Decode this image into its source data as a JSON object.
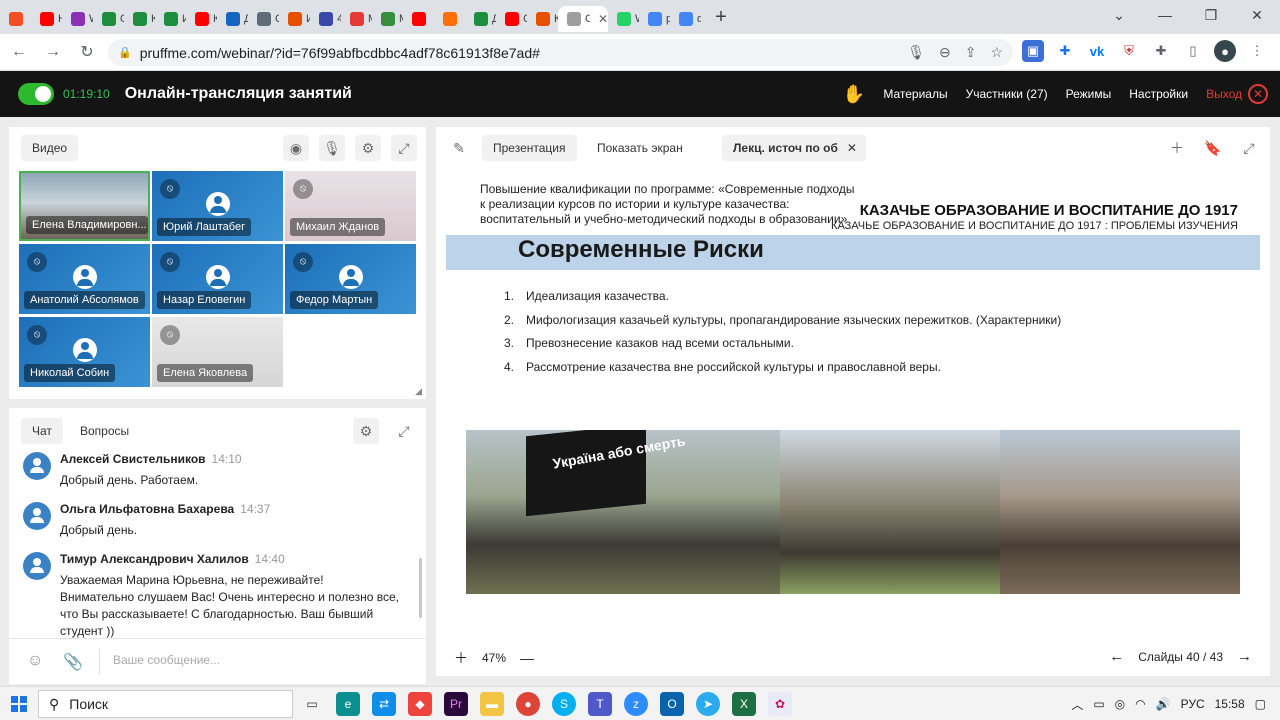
{
  "browser": {
    "tabs": [
      {
        "title": "",
        "color": "#f25022"
      },
      {
        "title": "Н",
        "color": "#ff0000"
      },
      {
        "title": "W",
        "color": "#8b2fb5"
      },
      {
        "title": "О",
        "color": "#1e8e3e"
      },
      {
        "title": "К",
        "color": "#1e8e3e"
      },
      {
        "title": "И",
        "color": "#1e8e3e"
      },
      {
        "title": "К",
        "color": "#ff0000"
      },
      {
        "title": "Д",
        "color": "#1565c0"
      },
      {
        "title": "О",
        "color": "#5f6d7a"
      },
      {
        "title": "И",
        "color": "#e65100"
      },
      {
        "title": "4",
        "color": "#3949ab"
      },
      {
        "title": "М",
        "color": "#e53935"
      },
      {
        "title": "М",
        "color": "#388e3c"
      },
      {
        "title": "",
        "color": "#ff0000"
      },
      {
        "title": "",
        "color": "#ff6f00"
      },
      {
        "title": "Д",
        "color": "#1e8e3e"
      },
      {
        "title": "С",
        "color": "#ff0000"
      },
      {
        "title": "К",
        "color": "#e65100"
      },
      {
        "title": "О",
        "color": "#9e9e9e",
        "active": true
      },
      {
        "title": "W",
        "color": "#25d366"
      },
      {
        "title": "p",
        "color": "#4285f4"
      },
      {
        "title": "ф",
        "color": "#4285f4"
      }
    ],
    "url": "pruffme.com/webinar/?id=76f99abfbcdbbc4adf78c61913f8e7ad#"
  },
  "header": {
    "timer": "01:19:10",
    "title": "Онлайн-трансляция занятий",
    "links": [
      "Материалы",
      "Участники (27)",
      "Режимы",
      "Настройки"
    ],
    "exit": "Выход"
  },
  "video": {
    "label": "Видео",
    "participants": [
      {
        "name": "Елена Владимировн...",
        "style": "cam"
      },
      {
        "name": "Юрий Лаштабег",
        "style": "blue"
      },
      {
        "name": "Михаил Жданов",
        "style": "photo1"
      },
      {
        "name": "Анатолий Абсолямов",
        "style": "blue"
      },
      {
        "name": "Назар Еловегин",
        "style": "blue"
      },
      {
        "name": "Федор Мартын",
        "style": "blue"
      },
      {
        "name": "Николай Собин",
        "style": "blue"
      },
      {
        "name": "Елена Яковлева",
        "style": "photo2"
      }
    ]
  },
  "chat": {
    "tabs": [
      "Чат",
      "Вопросы"
    ],
    "messages": [
      {
        "author": "Алексей Свистельников",
        "time": "14:10",
        "text": "Добрый день. Работаем."
      },
      {
        "author": "Ольга Ильфатовна Бахарева",
        "time": "14:37",
        "text": "Добрый день."
      },
      {
        "author": "Тимур Александрович Халилов",
        "time": "14:40",
        "text": "Уважаемая Марина Юрьевна, не переживайте! Внимательно слушаем Вас! Очень интересно и полезно все, что Вы рассказываете! С благодарностью. Ваш бывший студент ))"
      }
    ],
    "placeholder": "Ваше сообщение..."
  },
  "presentation": {
    "tabs": [
      "Презентация",
      "Показать экран"
    ],
    "file_tab": "Лекц. источ по об",
    "slide": {
      "intro": "Повышение квалификации по программе: «Современные подходы к реализации курсов по истории и культуре казачества: воспитательный и учебно-методический подходы в образовании»",
      "heading": "КАЗАЧЬЕ ОБРАЗОВАНИЕ И ВОСПИТАНИЕ ДО 1917",
      "subheading": "КАЗАЧЬЕ ОБРАЗОВАНИЕ И ВОСПИТАНИЕ ДО 1917 : ПРОБЛЕМЫ ИЗУЧЕНИЯ",
      "title": "Современные Риски",
      "items": [
        "Идеализация казачества.",
        "Мифологизация казачьей культуры, пропагандирование языческих пережитков. (Характерники)",
        "Превознесение казаков над всеми остальными.",
        "Рассмотрение казачества вне российской культуры и православной веры."
      ],
      "flag_text": "Украïна або смерть"
    },
    "zoom": "47%",
    "slides_label": "Слайды",
    "current_slide": "40",
    "total_slides": "43"
  },
  "taskbar": {
    "search": "Поиск",
    "lang": "РУС",
    "time": "15:58"
  }
}
